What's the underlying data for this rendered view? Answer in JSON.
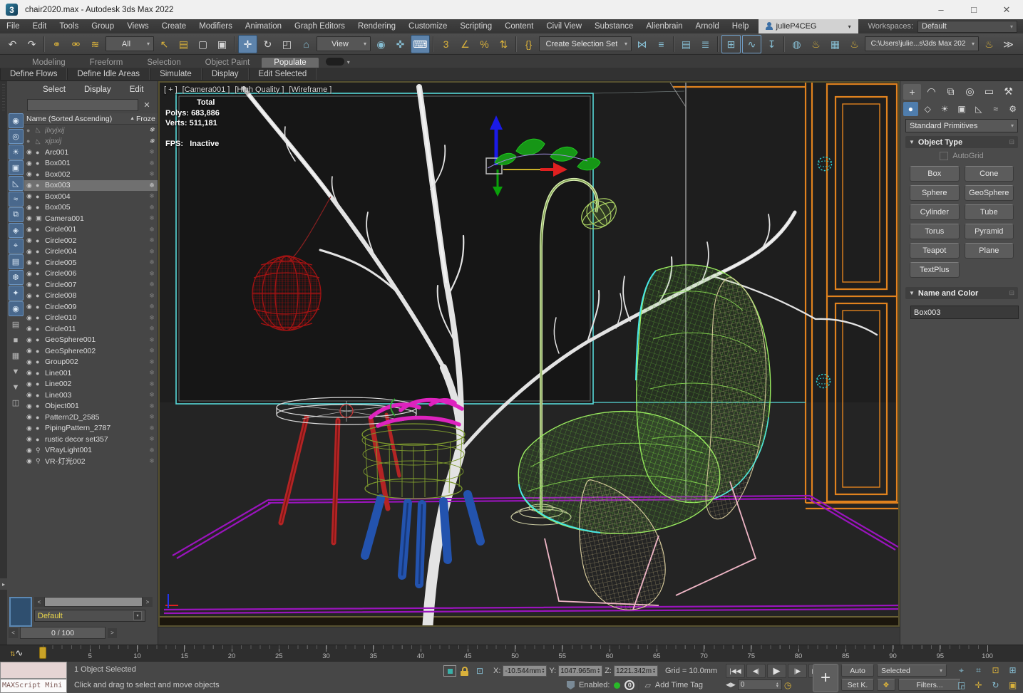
{
  "titlebar": {
    "logo": "3",
    "title": "chair2020.max - Autodesk 3ds Max 2022",
    "min": "–",
    "max": "□",
    "close": "✕"
  },
  "menubar": {
    "items": [
      "File",
      "Edit",
      "Tools",
      "Group",
      "Views",
      "Create",
      "Modifiers",
      "Animation",
      "Graph Editors",
      "Rendering",
      "Customize",
      "Scripting",
      "Content",
      "Civil View",
      "Substance",
      "Alienbrain",
      "Arnold",
      "Help"
    ]
  },
  "account": {
    "user": "julieP4CEG",
    "caret": "▾",
    "ws_label": "Workspaces:",
    "ws_value": "Default"
  },
  "toolbar": {
    "items": [
      {
        "g": "↶",
        "n": "undo-icon",
        "ia": "true"
      },
      {
        "g": "↷",
        "n": "redo-icon",
        "ia": "true"
      },
      {
        "c": "sep",
        "n": "toolbar-separator",
        "ia": "false"
      },
      {
        "g": "⚭",
        "n": "select-and-link-icon",
        "c": "au",
        "ia": "true"
      },
      {
        "g": "⚮",
        "n": "unlink-selection-icon",
        "c": "au",
        "ia": "true"
      },
      {
        "g": "≋",
        "n": "bind-to-space-warp-icon",
        "c": "au",
        "ia": "true"
      },
      {
        "label": "All",
        "caret": "▾",
        "c": "dd w56",
        "n": "selection-filter-dropdown",
        "ia": "true"
      },
      {
        "g": "↖",
        "n": "select-object-icon",
        "c": "au",
        "ia": "true"
      },
      {
        "g": "▤",
        "n": "select-by-name-icon",
        "c": "au",
        "ia": "true"
      },
      {
        "g": "▢",
        "n": "rectangular-selection-region-icon",
        "ia": "true"
      },
      {
        "g": "▣",
        "n": "window-crossing-toggle-icon",
        "ia": "true"
      },
      {
        "c": "sep",
        "n": "toolbar-separator",
        "ia": "false"
      },
      {
        "g": "✛",
        "n": "select-and-move-icon",
        "c": "on",
        "ia": "true"
      },
      {
        "g": "↻",
        "n": "select-and-rotate-icon",
        "ia": "true"
      },
      {
        "g": "◰",
        "n": "select-and-scale-icon",
        "ia": "true"
      },
      {
        "g": "⌂",
        "n": "select-and-place-icon",
        "c": "te",
        "ia": "true"
      },
      {
        "label": "View",
        "caret": "▾",
        "c": "dd w64",
        "n": "reference-coordinate-system-dropdown",
        "ia": "true"
      },
      {
        "g": "◉",
        "n": "use-pivot-point-center-icon",
        "c": "te",
        "ia": "true"
      },
      {
        "g": "✜",
        "n": "select-and-manipulate-icon",
        "c": "te",
        "ia": "true"
      },
      {
        "g": "⌨",
        "n": "keyboard-shortcut-override-icon",
        "c": "on",
        "ia": "true"
      },
      {
        "c": "sep",
        "n": "toolbar-separator",
        "ia": "false"
      },
      {
        "g": "3",
        "n": "snaps-toggle-3d-icon",
        "c": "au",
        "ia": "true"
      },
      {
        "g": "∠",
        "n": "angle-snap-toggle-icon",
        "c": "au",
        "ia": "true"
      },
      {
        "g": "%",
        "n": "percent-snap-toggle-icon",
        "c": "au",
        "ia": "true"
      },
      {
        "g": "⇅",
        "n": "spinner-snap-toggle-icon",
        "c": "au",
        "ia": "true"
      },
      {
        "c": "sep",
        "n": "toolbar-separator",
        "ia": "false"
      },
      {
        "g": "{}",
        "n": "mxs-debugger-icon",
        "c": "au",
        "ia": "true"
      },
      {
        "label": "Create Selection Set",
        "caret": "▾",
        "c": "dd w118",
        "n": "named-selection-sets-dropdown",
        "ia": "true"
      },
      {
        "g": "⋈",
        "n": "mirror-icon",
        "c": "te",
        "ia": "true"
      },
      {
        "g": "≡",
        "n": "align-icon",
        "c": "te",
        "ia": "true"
      },
      {
        "c": "sep",
        "n": "toolbar-separator",
        "ia": "false"
      },
      {
        "g": "▤",
        "n": "toggle-scene-explorer-icon",
        "c": "te",
        "ia": "true"
      },
      {
        "g": "≣",
        "n": "toggle-layer-explorer-icon",
        "c": "te",
        "ia": "true"
      },
      {
        "c": "sep",
        "n": "toolbar-separator",
        "ia": "false"
      },
      {
        "g": "⊞",
        "n": "toggle-ribbon-icon",
        "c": "fr te",
        "ia": "true"
      },
      {
        "g": "∿",
        "n": "curve-editor-icon",
        "c": "fr te",
        "ia": "true"
      },
      {
        "g": "↧",
        "n": "dope-sheet-icon",
        "c": "te",
        "ia": "true"
      },
      {
        "c": "sep",
        "n": "toolbar-separator",
        "ia": "false"
      },
      {
        "g": "◍",
        "n": "material-editor-icon",
        "c": "te",
        "ia": "true"
      },
      {
        "g": "♨",
        "n": "render-setup-icon",
        "c": "au",
        "ia": "true"
      },
      {
        "g": "▦",
        "n": "rendered-frame-window-icon",
        "c": "te",
        "ia": "true"
      },
      {
        "g": "♨",
        "n": "render-production-icon",
        "c": "au",
        "ia": "true"
      },
      {
        "label": "C:\\Users\\julie...s\\3ds Max 202",
        "caret": "▾",
        "c": "dd w148 small",
        "n": "project-folder-dropdown",
        "ia": "true"
      },
      {
        "g": "♨",
        "n": "render-iterative-icon",
        "c": "au",
        "ia": "true"
      },
      {
        "g": "≫",
        "n": "toolbar-overflow-icon",
        "ia": "true"
      }
    ]
  },
  "ribbon": {
    "tabs": [
      {
        "label": "Modeling",
        "c": ""
      },
      {
        "label": "Freeform",
        "c": ""
      },
      {
        "label": "Selection",
        "c": ""
      },
      {
        "label": "Object Paint",
        "c": ""
      },
      {
        "label": "Populate",
        "c": "active"
      }
    ],
    "caret": "▾",
    "tools": [
      "Define Flows",
      "Define Idle Areas",
      "Simulate",
      "Display",
      "Edit Selected"
    ]
  },
  "explorer": {
    "tabs": [
      "Select",
      "Display",
      "Edit"
    ],
    "clear_icon": "✕",
    "header": {
      "name": "Name (Sorted Ascending)",
      "sort": "▲",
      "frozen": "Froze"
    },
    "icons": {
      "snow": "❄"
    },
    "rail": [
      {
        "g": "◉",
        "n": "rail-display-geometry-icon",
        "c": "blue"
      },
      {
        "g": "◎",
        "n": "rail-display-shapes-icon",
        "c": "blue"
      },
      {
        "g": "☀",
        "n": "rail-display-lights-icon",
        "c": "blue"
      },
      {
        "g": "▣",
        "n": "rail-display-cameras-icon",
        "c": "blue"
      },
      {
        "g": "◺",
        "n": "rail-display-helpers-icon",
        "c": "blue"
      },
      {
        "g": "≈",
        "n": "rail-display-spacewarps-icon",
        "c": "blue"
      },
      {
        "g": "⧉",
        "n": "rail-display-groups-icon",
        "c": "blue"
      },
      {
        "g": "◈",
        "n": "rail-display-xrefs-icon",
        "c": "blue"
      },
      {
        "g": "⌖",
        "n": "rail-display-bones-icon",
        "c": "blue"
      },
      {
        "g": "▤",
        "n": "rail-display-containers-icon",
        "c": "blue"
      },
      {
        "g": "❆",
        "n": "rail-display-frozen-icon",
        "c": "blue"
      },
      {
        "g": "✦",
        "n": "rail-display-particles-icon",
        "c": "blue"
      },
      {
        "g": "◉",
        "n": "rail-display-hidden-icon",
        "c": "blue"
      },
      {
        "g": "▤",
        "n": "rail-layer-explorer-icon",
        "c": "gray"
      },
      {
        "g": "■",
        "n": "rail-container-explorer-icon",
        "c": "gray"
      },
      {
        "g": "▦",
        "n": "rail-note-track-icon",
        "c": "gray"
      },
      {
        "g": "▼",
        "n": "rail-clear-filter-icon",
        "c": "gray"
      },
      {
        "g": "▼",
        "n": "rail-filter-icon",
        "c": "gray"
      },
      {
        "g": "◫",
        "n": "rail-box-mode-icon",
        "c": "gray"
      }
    ],
    "rows": [
      {
        "n": "jlxyjxij",
        "c": "frozen",
        "e": "●",
        "g": "◺"
      },
      {
        "n": "xjpxij",
        "c": "frozen",
        "e": "●",
        "g": "◺"
      },
      {
        "n": "Arc001",
        "c": "",
        "e": "◉",
        "g": "●"
      },
      {
        "n": "Box001",
        "c": "",
        "e": "◉",
        "g": "●"
      },
      {
        "n": "Box002",
        "c": "",
        "e": "◉",
        "g": "●"
      },
      {
        "n": "Box003",
        "c": "selected",
        "e": "◉",
        "g": "●"
      },
      {
        "n": "Box004",
        "c": "",
        "e": "◉",
        "g": "●"
      },
      {
        "n": "Box005",
        "c": "",
        "e": "◉",
        "g": "●"
      },
      {
        "n": "Camera001",
        "c": "",
        "e": "◉",
        "g": "▣"
      },
      {
        "n": "Circle001",
        "c": "",
        "e": "◉",
        "g": "●"
      },
      {
        "n": "Circle002",
        "c": "",
        "e": "◉",
        "g": "●"
      },
      {
        "n": "Circle004",
        "c": "",
        "e": "◉",
        "g": "●"
      },
      {
        "n": "Circle005",
        "c": "",
        "e": "◉",
        "g": "●"
      },
      {
        "n": "Circle006",
        "c": "",
        "e": "◉",
        "g": "●"
      },
      {
        "n": "Circle007",
        "c": "",
        "e": "◉",
        "g": "●"
      },
      {
        "n": "Circle008",
        "c": "",
        "e": "◉",
        "g": "●"
      },
      {
        "n": "Circle009",
        "c": "",
        "e": "◉",
        "g": "●"
      },
      {
        "n": "Circle010",
        "c": "",
        "e": "◉",
        "g": "●"
      },
      {
        "n": "Circle011",
        "c": "",
        "e": "◉",
        "g": "●"
      },
      {
        "n": "GeoSphere001",
        "c": "",
        "e": "◉",
        "g": "●"
      },
      {
        "n": "GeoSphere002",
        "c": "",
        "e": "◉",
        "g": "●"
      },
      {
        "n": "Group002",
        "c": "",
        "e": "◉",
        "g": "●"
      },
      {
        "n": "Line001",
        "c": "",
        "e": "◉",
        "g": "●"
      },
      {
        "n": "Line002",
        "c": "",
        "e": "◉",
        "g": "●"
      },
      {
        "n": "Line003",
        "c": "",
        "e": "◉",
        "g": "●"
      },
      {
        "n": "Object001",
        "c": "",
        "e": "◉",
        "g": "●"
      },
      {
        "n": "Pattern2D_2585",
        "c": "",
        "e": "◉",
        "g": "●"
      },
      {
        "n": "PipingPattern_2787",
        "c": "",
        "e": "◉",
        "g": "●"
      },
      {
        "n": "rustic decor set357",
        "c": "",
        "e": "◉",
        "g": "●"
      },
      {
        "n": "VRayLight001",
        "c": "",
        "e": "◉",
        "g": "⚲"
      },
      {
        "n": "VR-灯光002",
        "c": "",
        "e": "◉",
        "g": "⚲"
      }
    ],
    "scroll_left": "<",
    "scroll_right": ">",
    "layer": "Default",
    "frame_left": "<",
    "frame_indicator": "0 / 100",
    "frame_right": ">"
  },
  "viewport": {
    "label_parts": [
      "[ + ]",
      "[Camera001 ]",
      "[High Quality ]",
      "[Wireframe ]"
    ],
    "stats": {
      "total": "Total",
      "polys": "Polys: 683,886",
      "verts": "Verts: 511,181",
      "fps": "FPS:   Inactive"
    }
  },
  "command_panel": {
    "tabs": [
      {
        "g": "+",
        "n": "create-tab-icon",
        "c": "active"
      },
      {
        "g": "◠",
        "n": "modify-tab-icon",
        "c": ""
      },
      {
        "g": "⧉",
        "n": "hierarchy-tab-icon",
        "c": ""
      },
      {
        "g": "◎",
        "n": "motion-tab-icon",
        "c": ""
      },
      {
        "g": "▭",
        "n": "display-tab-icon",
        "c": ""
      },
      {
        "g": "⚒",
        "n": "utilities-tab-icon",
        "c": ""
      }
    ],
    "categories": [
      {
        "g": "●",
        "n": "geometry-category-icon",
        "c": "active"
      },
      {
        "g": "◇",
        "n": "shapes-category-icon",
        "c": ""
      },
      {
        "g": "☀",
        "n": "lights-category-icon",
        "c": ""
      },
      {
        "g": "▣",
        "n": "cameras-category-icon",
        "c": ""
      },
      {
        "g": "◺",
        "n": "helpers-category-icon",
        "c": ""
      },
      {
        "g": "≈",
        "n": "space-warps-category-icon",
        "c": ""
      },
      {
        "g": "⚙",
        "n": "systems-category-icon",
        "c": ""
      }
    ],
    "category_dropdown": "Standard Primitives",
    "caret": "▾",
    "roll_caret": "▼",
    "pin": "⊟",
    "object_type_label": "Object Type",
    "autogrid_label": "AutoGrid",
    "object_buttons": [
      "Box",
      "Cone",
      "Sphere",
      "GeoSphere",
      "Cylinder",
      "Tube",
      "Torus",
      "Pyramid",
      "Teapot",
      "Plane",
      "TextPlus"
    ],
    "name_color_label": "Name and Color",
    "object_name": "Box003",
    "object_color": "#a6dff0"
  },
  "timeline": {
    "labels": [
      "5",
      "10",
      "15",
      "20",
      "25",
      "30",
      "35",
      "40",
      "45",
      "50",
      "55",
      "60",
      "65",
      "70",
      "75",
      "80",
      "85",
      "90",
      "95",
      "100"
    ],
    "curve_icon": "∿"
  },
  "statusbar": {
    "maxscript_label": "MAXScript Mini",
    "selected_info": "1 Object Selected",
    "prompt": "Click and drag to select and move objects",
    "x_label": "X:",
    "x_value": "-10.544mm",
    "y_label": "Y:",
    "y_value": "1047.965m",
    "z_label": "Z:",
    "z_value": "1221.342m",
    "grid": "Grid = 10.0mm",
    "enabled_label": "Enabled:",
    "counter": "0",
    "add_time_tag": "Add Time Tag",
    "cube_icon": "▱",
    "playback": [
      {
        "g": "|◀◀",
        "n": "go-to-start-button"
      },
      {
        "g": "◀|",
        "n": "previous-frame-button"
      },
      {
        "g": "▶",
        "n": "play-button",
        "c": "play"
      },
      {
        "g": "|▶",
        "n": "next-frame-button"
      },
      {
        "g": "▶▶|",
        "n": "go-to-end-button"
      }
    ],
    "keymode": "◀▶",
    "frame_field": "0",
    "clock": "◷",
    "set_key_plus": "+",
    "auto": "Auto",
    "selected_dd": "Selected",
    "caret": "▾",
    "set_k": "Set K.",
    "key_filter": "❖",
    "filters": "Filters...",
    "nav1": [
      {
        "g": "⌖",
        "n": "zoom-icon"
      },
      {
        "g": "⌗",
        "n": "zoom-all-icon"
      },
      {
        "g": "⊡",
        "n": "zoom-extents-icon",
        "c": "g"
      },
      {
        "g": "⊞",
        "n": "zoom-extents-all-icon"
      }
    ],
    "nav2": [
      {
        "g": "◲",
        "n": "zoom-region-icon"
      },
      {
        "g": "✛",
        "n": "pan-icon",
        "c": "g"
      },
      {
        "g": "↻",
        "n": "orbit-icon"
      },
      {
        "g": "▣",
        "n": "maximize-viewport-icon",
        "c": "g"
      }
    ],
    "spin": "▲▼"
  },
  "colors": {
    "accent_blue": "#5d83ab",
    "icon_gold": "#d9b13b",
    "icon_teal": "#86bdd2",
    "selection_cyan": "#46e6e6"
  }
}
